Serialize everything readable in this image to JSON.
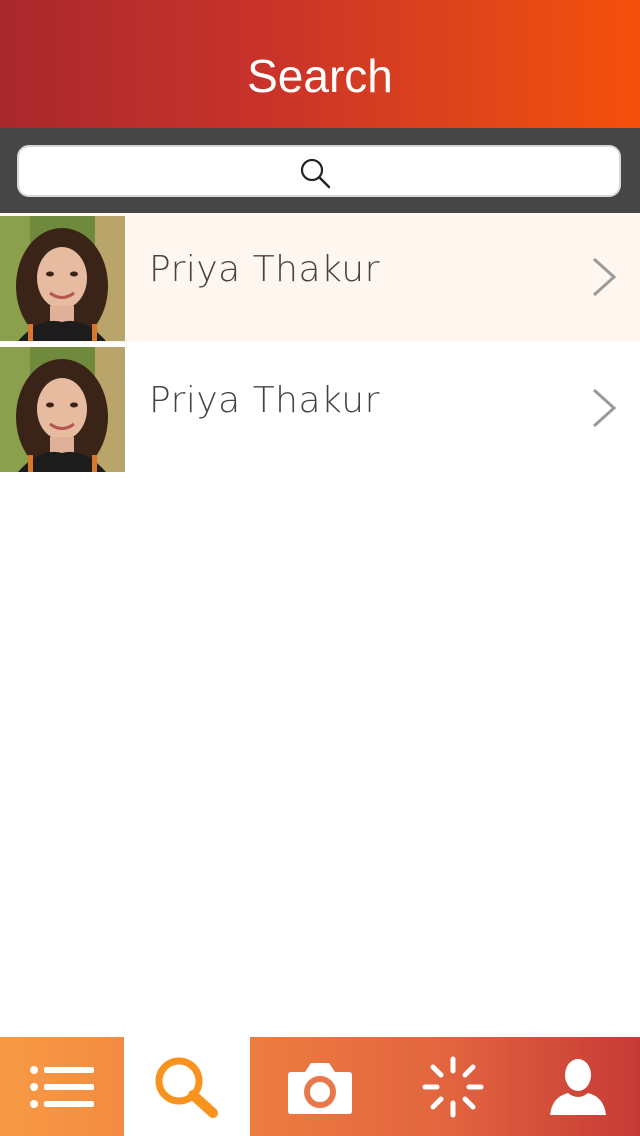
{
  "header": {
    "title": "Search",
    "gradient_start": "#a9282d",
    "gradient_end": "#f5500a"
  },
  "search": {
    "value": "",
    "placeholder": "",
    "icon": "search-icon"
  },
  "results": [
    {
      "name": "Priya Thakur",
      "highlighted": true,
      "icon": "chevron-right-icon"
    },
    {
      "name": "Priya Thakur",
      "highlighted": false,
      "icon": "chevron-right-icon"
    }
  ],
  "tabbar": {
    "tabs": [
      {
        "icon": "list-icon",
        "active": false
      },
      {
        "icon": "search-icon",
        "active": true,
        "active_color": "#f7931e"
      },
      {
        "icon": "camera-icon",
        "active": false
      },
      {
        "icon": "loading-spinner-icon",
        "active": false
      },
      {
        "icon": "person-icon",
        "active": false
      }
    ]
  }
}
